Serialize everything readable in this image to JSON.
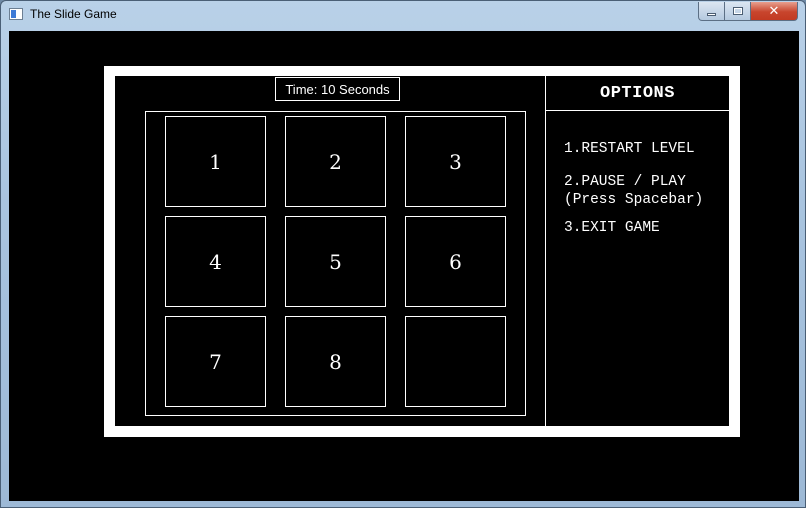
{
  "window": {
    "title": "The Slide Game",
    "controls": {
      "minimize": "minimize",
      "maximize": "maximize",
      "close": "✕"
    }
  },
  "game": {
    "timer_text": "Time: 10 Seconds",
    "tiles": [
      "1",
      "2",
      "3",
      "4",
      "5",
      "6",
      "7",
      "8",
      ""
    ],
    "empty_tile_index": 8
  },
  "options": {
    "title": "OPTIONS",
    "items": [
      {
        "label": "1.RESTART LEVEL"
      },
      {
        "label": "2.PAUSE / PLAY\n(Press Spacebar)"
      },
      {
        "label": "3.EXIT GAME"
      }
    ]
  },
  "colors": {
    "background": "#000000",
    "foreground": "#ffffff",
    "close_button": "#c8452d"
  }
}
